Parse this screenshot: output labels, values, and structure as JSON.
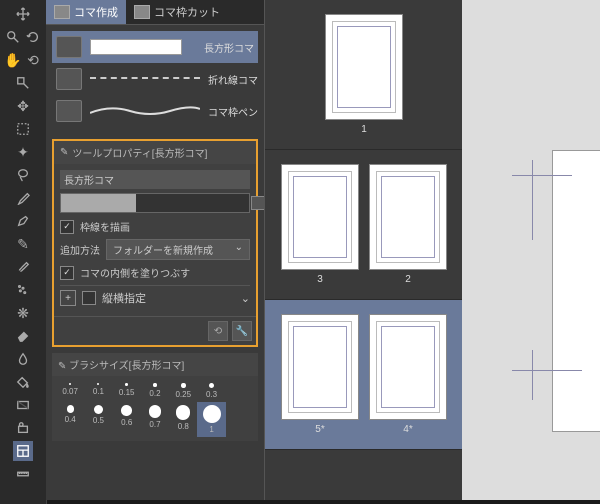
{
  "tabs": [
    {
      "label": "コマ作成",
      "active": true
    },
    {
      "label": "コマ枠カット",
      "active": false
    }
  ],
  "subtools": [
    {
      "label": "長方形コマ",
      "selected": true,
      "type": "rect"
    },
    {
      "label": "折れ線コマ",
      "selected": false,
      "type": "dash"
    },
    {
      "label": "コマ枠ペン",
      "selected": false,
      "type": "wave"
    }
  ],
  "propPanel": {
    "header": "ツールプロパティ[長方形コマ]",
    "title": "長方形コマ",
    "drawBorder": {
      "checked": true,
      "label": "枠線を描画"
    },
    "addMethod": {
      "label": "追加方法",
      "value": "フォルダーを新規作成"
    },
    "fillInside": {
      "checked": true,
      "label": "コマの内側を塗りつぶす"
    },
    "aspectLock": {
      "label": "縦横指定"
    }
  },
  "brushPanel": {
    "header": "ブラシサイズ[長方形コマ]",
    "sizes": [
      0.07,
      0.1,
      0.15,
      0.2,
      0.25,
      0.3,
      0.4,
      0.5,
      0.6,
      0.7,
      0.8,
      1
    ]
  },
  "thumbs": [
    {
      "pages": [
        {
          "label": "1"
        }
      ],
      "selected": false
    },
    {
      "pages": [
        {
          "label": "3"
        },
        {
          "label": "2"
        }
      ],
      "selected": false
    },
    {
      "pages": [
        {
          "label": "5*"
        },
        {
          "label": "4*"
        }
      ],
      "selected": true
    }
  ]
}
